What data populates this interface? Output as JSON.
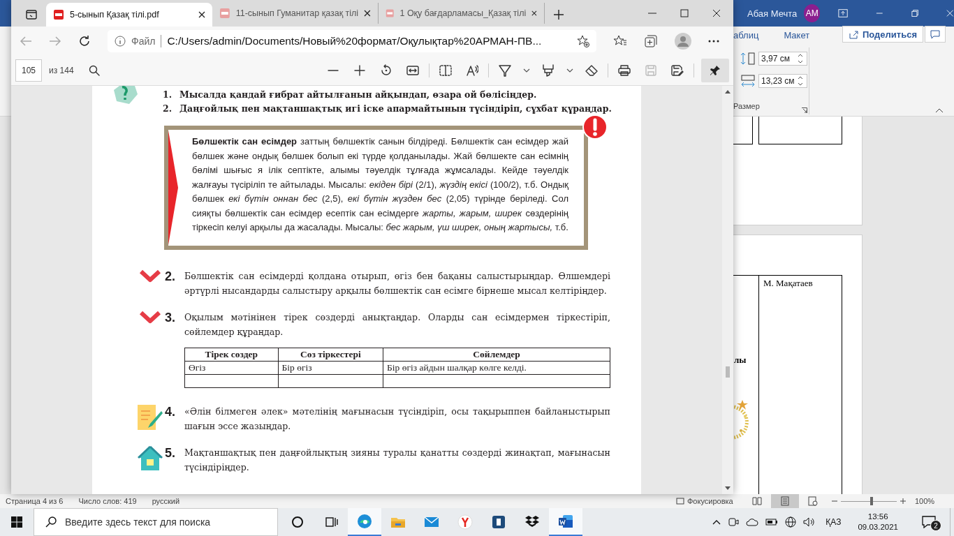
{
  "word_window": {
    "user_name": "Абая Мечта",
    "avatar": "AM",
    "ribbon_tabs": [
      {
        "label": "аблиц"
      },
      {
        "label": "Макет"
      }
    ],
    "share_button": "Поделиться",
    "size_group": {
      "height": "3,97 см",
      "width": "13,23 см",
      "label": "Размер"
    },
    "document": {
      "author_cell": "М. Мақатаев",
      "cut_cell": "лы"
    },
    "status_bar": {
      "page": "Страница 4 из 6",
      "words": "Число слов: 419",
      "language": "русский",
      "focus": "Фокусировка",
      "zoom": "100%",
      "zoom_slider": {
        "level": 0.55
      }
    }
  },
  "browser": {
    "tabs": [
      {
        "label": "5-сынып Қазақ тілі.pdf",
        "selected": true
      },
      {
        "label": "11-сынып Гуманитар қазақ тілі",
        "selected": false
      },
      {
        "label": "1 Оқу бағдарламасы_Қазақ тілі",
        "selected": false
      }
    ],
    "address": {
      "scheme": "Файл",
      "url": "C:/Users/admin/Documents/Новый%20формат/Оқулықтар%20АРМАН-ПВ..."
    },
    "pdf_toolbar": {
      "page": "105",
      "total": "из 144"
    },
    "pdf_page": {
      "questions": [
        {
          "number": "1.",
          "text": "Мысалда қандай ғибрат айтылғанын айқындап, өзара ой бөлісіңдер."
        },
        {
          "number": "2.",
          "text": "Даңғойлық пен мақтаншақтық игі іске апармайтынын түсіндіріп, сұхбат құраңдар."
        }
      ],
      "rule_box": "**Бөлшектік сан есімдер** заттың бөлшектік санын білдіреді. Бөлшектік сан есімдер жай бөлшек және ондық бөлшек болып екі түрде қолданылады. Жай бөлшекте сан есімнің бөлімі шығыс я ілік септікте, алымы тәуелдік тұлғада жұмсалады. Кейде тәуелдік жалғауы түсіріліп те айтылады. Мысалы: *екіден бірі* (2/1), *жүздің екісі* (100/2), т.б. Ондық бөлшек *екі бүтін оннан бес* (2,5), *екі бүтін жүзден бес* (2,05) түрінде беріледі. Сол сияқты бөлшектік сан есімдер есептік сан есімдерге *жарты, жарым, ширек* сөздерінің тіркесіп келуі арқылы да жасалады. Мысалы: *бес жарым, үш ширек, оның жартысы,* т.б.",
      "tasks": [
        {
          "kind": "check",
          "number": "2.",
          "text": "Бөлшектік сан есімдерді қолдана отырып, өгіз бен бақаны салыстырыңдар. Өлшемдері әртүрлі нысандарды салыстыру арқылы бөлшектік сан есімге бірнеше мысал келтіріңдер."
        },
        {
          "kind": "check",
          "number": "3.",
          "text": "Оқылым мәтінінен тірек сөздерді анықтаңдар. Оларды сан есімдермен тіркестіріп, сөйлемдер құраңдар.",
          "table": {
            "columns": [
              "Тірек сөздер",
              "Сөз тіркестері",
              "Сөйлемдер"
            ],
            "rows": [
              [
                "Өгіз",
                "Бір өгіз",
                "Бір өгіз айдын шалқар көлге келді."
              ]
            ]
          }
        },
        {
          "kind": "write",
          "number": "4.",
          "text": "«Әлін білмеген әлек» мәтелінің мағынасын түсіндіріп, осы тақырыппен байланыстырып шағын эссе жазыңдар."
        },
        {
          "kind": "home",
          "number": "5.",
          "text": "Мақтаншақтық пен даңғойлықтың зияны туралы қанатты сөздерді жинақтап, мағынасын түсіндіріңдер."
        }
      ]
    }
  },
  "taskbar": {
    "search_placeholder": "Введите здесь текст для поиска",
    "language": "ҚАЗ",
    "time": "13:56",
    "date": "09.03.2021",
    "notifications": "2"
  }
}
